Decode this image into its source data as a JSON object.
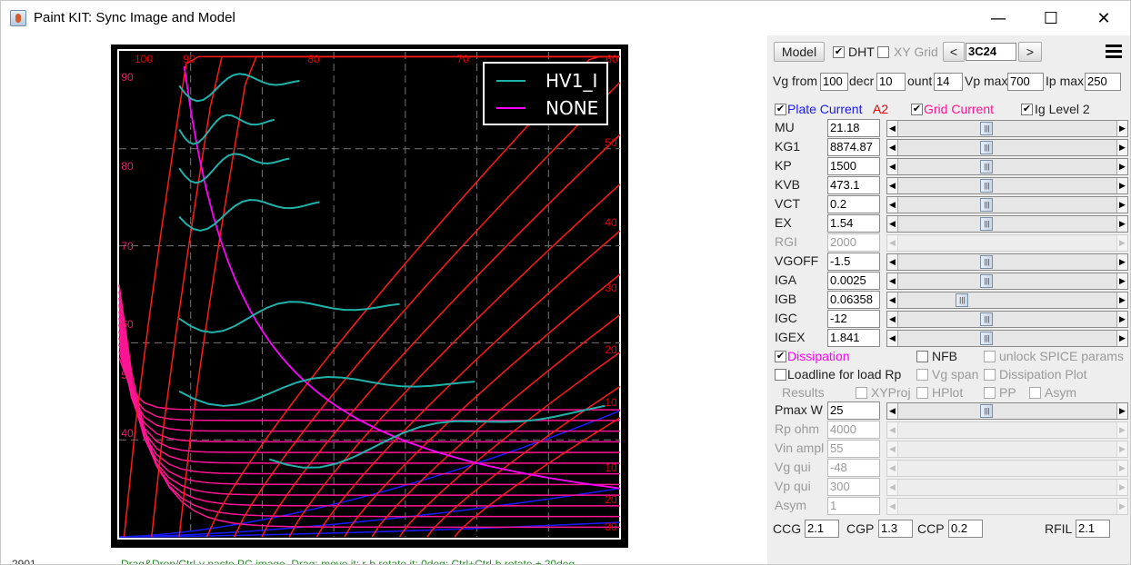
{
  "window": {
    "title": "Paint KIT: Sync Image and Model",
    "minimize": "—",
    "maximize": "☐",
    "close": "✕"
  },
  "toolbar": {
    "model_button": "Model",
    "dht_label": "DHT",
    "dht_checked": true,
    "xygrid_label": "XY Grid",
    "xygrid_checked": false,
    "prev": "<",
    "tube": "3C24",
    "next": ">"
  },
  "sweep": {
    "vg_from_label": "Vg from",
    "vg_from": "100",
    "decr_label": "decr",
    "decr": "10",
    "count_label": "ount",
    "count": "14",
    "vp_max_label": "Vp max",
    "vp_max": "700",
    "ip_max_label": "Ip max",
    "ip_max": "250"
  },
  "toggles": {
    "plate_current": "Plate Current",
    "plate_current_color": "#1a1aff",
    "a2": "A2",
    "grid_current": "Grid Current",
    "grid_current_color": "#ff1493",
    "ig_level2": "Ig Level 2"
  },
  "params": [
    {
      "name": "MU",
      "value": "21.18",
      "enabled": true,
      "thumb": 0.4
    },
    {
      "name": "KG1",
      "value": "8874.87",
      "enabled": true,
      "thumb": 0.4
    },
    {
      "name": "KP",
      "value": "1500",
      "enabled": true,
      "thumb": 0.4
    },
    {
      "name": "KVB",
      "value": "473.1",
      "enabled": true,
      "thumb": 0.4
    },
    {
      "name": "VCT",
      "value": "0.2",
      "enabled": true,
      "thumb": 0.4
    },
    {
      "name": "EX",
      "value": "1.54",
      "enabled": true,
      "thumb": 0.4
    },
    {
      "name": "RGI",
      "value": "2000",
      "enabled": false,
      "thumb": null
    },
    {
      "name": "VGOFF",
      "value": "-1.5",
      "enabled": true,
      "thumb": 0.4
    },
    {
      "name": "IGA",
      "value": "0.0025",
      "enabled": true,
      "thumb": 0.4
    },
    {
      "name": "IGB",
      "value": "0.06358",
      "enabled": true,
      "thumb": 0.28
    },
    {
      "name": "IGC",
      "value": "-12",
      "enabled": true,
      "thumb": 0.4
    },
    {
      "name": "IGEX",
      "value": "1.841",
      "enabled": true,
      "thumb": 0.4
    }
  ],
  "options": {
    "dissipation": "Dissipation",
    "dissipation_color": "#ff00ff",
    "nfb": "NFB",
    "unlock_spice": "unlock SPICE params",
    "loadline": "Loadline for load Rp",
    "vg_span": "Vg span",
    "dissipation_plot": "Dissipation Plot",
    "results": "Results",
    "xyproj": "XYProj",
    "hplot": "HPlot",
    "pp": "PP",
    "asym": "Asym"
  },
  "power": [
    {
      "name": "Pmax W",
      "value": "25",
      "enabled": true,
      "thumb": 0.4
    },
    {
      "name": "Rp ohm",
      "value": "4000",
      "enabled": false,
      "thumb": null
    },
    {
      "name": "Vin ampl",
      "value": "55",
      "enabled": false,
      "thumb": null
    },
    {
      "name": "Vg qui",
      "value": "-48",
      "enabled": false,
      "thumb": null
    },
    {
      "name": "Vp qui",
      "value": "300",
      "enabled": false,
      "thumb": null
    },
    {
      "name": "Asym",
      "value": "1",
      "enabled": false,
      "thumb": null
    }
  ],
  "caps": {
    "ccg_label": "CCG",
    "ccg": "2.1",
    "cgp_label": "CGP",
    "cgp": "1.3",
    "ccp_label": "CCP",
    "ccp": "0.2",
    "rfil_label": "RFIL",
    "rfil": "2.1"
  },
  "plot": {
    "legend": [
      {
        "name": "HV1_I",
        "color": "#20b2aa"
      },
      {
        "name": "NONE",
        "color": "#ff00ff"
      }
    ],
    "image_labels_top": [
      "100",
      "90",
      "80",
      "70",
      "60"
    ],
    "image_labels_right": [
      "50",
      "40",
      "30",
      "20",
      "10",
      "10",
      "20",
      "30"
    ],
    "image_labels_left": [
      "90",
      "80",
      "70",
      "60",
      "50",
      "40"
    ],
    "model_color": "#ff1a1a",
    "grid_color": "#ff1493",
    "plate_color": "#1a1aff",
    "dissipation_color": "#ff00ff",
    "trace_color": "#20b2aa"
  },
  "status": {
    "coords": "2901",
    "hint": "Drag&Drop/Ctrl-v paste PC image. Drag: move it; r-b rotate it; 0deg; Ctrl+Ctrl-b rotate ±.20deg"
  }
}
